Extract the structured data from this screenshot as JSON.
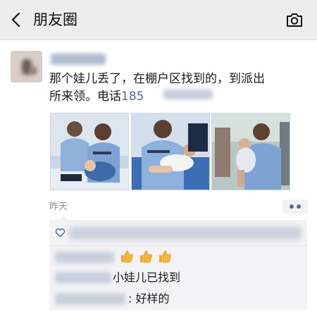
{
  "header": {
    "back_icon": "chevron-left-icon",
    "title": "朋友圈",
    "camera_icon": "camera-icon",
    "background": "#ededed"
  },
  "post": {
    "text_line1": "那个娃儿丢了，在棚户区找到的，到派出",
    "text_line2_prefix": "所来领。电话",
    "phone_visible": "185",
    "time": "昨天",
    "more_icon": "more-dots-icon",
    "photos": [
      {
        "description": "police officer crouching and holding a child on his lap"
      },
      {
        "description": "police officer cradling a sleeping child"
      },
      {
        "description": "police officer carrying a child in his arms"
      }
    ]
  },
  "interactions": {
    "like_icon": "heart-outline-icon",
    "comments": [
      {
        "text": "",
        "emoji": "thumbs-up-icon x3"
      },
      {
        "text": "小娃儿已找到"
      },
      {
        "text": ": 好样的"
      }
    ]
  },
  "colors": {
    "link": "#576b95",
    "comment_bg": "#f3f3f5",
    "time_text": "#8e8e8e"
  }
}
